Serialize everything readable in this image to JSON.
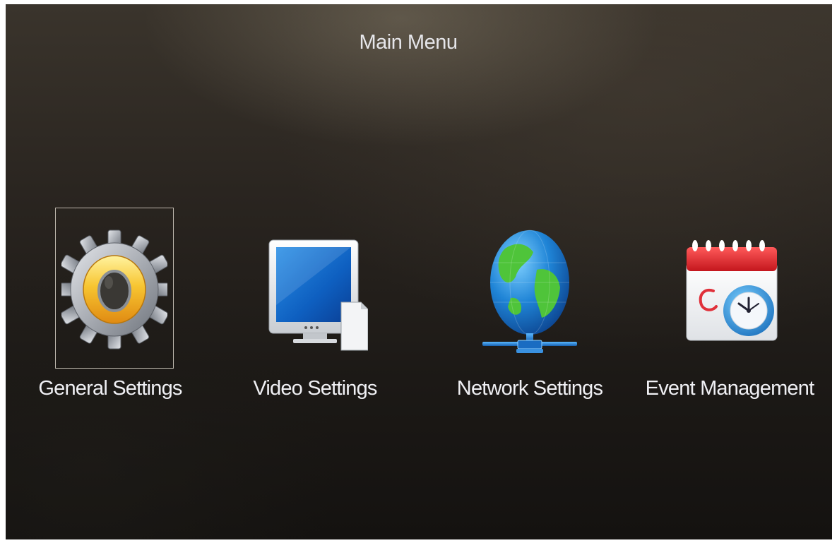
{
  "screen": {
    "title": "Main Menu"
  },
  "menu": {
    "items": [
      {
        "label": "General Settings",
        "icon": "gear-icon",
        "selected": true
      },
      {
        "label": "Video Settings",
        "icon": "monitor-icon",
        "selected": false
      },
      {
        "label": "Network Settings",
        "icon": "globe-network-icon",
        "selected": false
      },
      {
        "label": "Event Management",
        "icon": "calendar-clock-icon",
        "selected": false
      }
    ]
  },
  "colors": {
    "background": "#1c1916",
    "text": "#f0f0f4",
    "selection_border": "#bdb7ad",
    "gear_accent": "#f2b320",
    "calendar_header": "#d8232a",
    "clock_ring": "#1f8fd8"
  }
}
